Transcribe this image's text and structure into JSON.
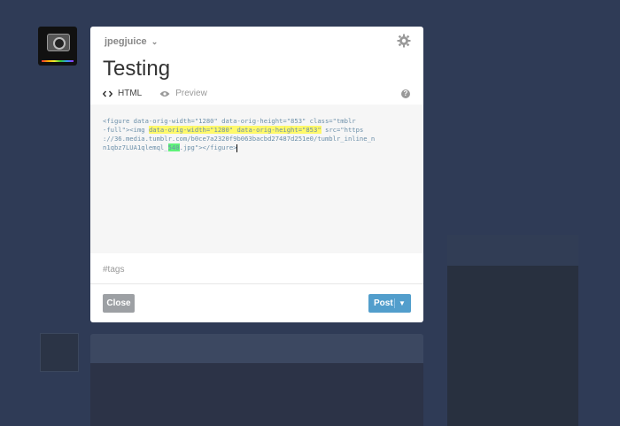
{
  "blog": {
    "name": "jpegjuice",
    "avatar_label": "@JPEGJuice"
  },
  "post": {
    "title": "Testing",
    "tags_placeholder": "#tags"
  },
  "tabs": [
    {
      "label": "HTML",
      "icon": "code-icon",
      "active": true
    },
    {
      "label": "Preview",
      "icon": "eye-icon",
      "active": false
    }
  ],
  "editor": {
    "line1_a": "<figure data-orig-width=\"1280\" data-orig-height=\"853\" class=\"tmblr",
    "line2_a": "-full\"><img ",
    "line2_hl": "data-orig-width=\"1280\" data-orig-height=\"853\"",
    "line2_b": " src=\"https",
    "line3": "://36.media.tumblr.com/b0ce7a2320f9b063bacbd27487d251e0/tumblr_inline_n",
    "line4_a": "n1qbz7LUA1qlemql_",
    "line4_hl": "540",
    "line4_b": ".jpg\"></figure>"
  },
  "footer": {
    "close_label": "Close",
    "post_label": "Post"
  },
  "colors": {
    "post_button": "#529ecc",
    "close_button": "#9da0a4",
    "highlight_yellow": "#fff96a",
    "highlight_green": "#5ff27a"
  }
}
